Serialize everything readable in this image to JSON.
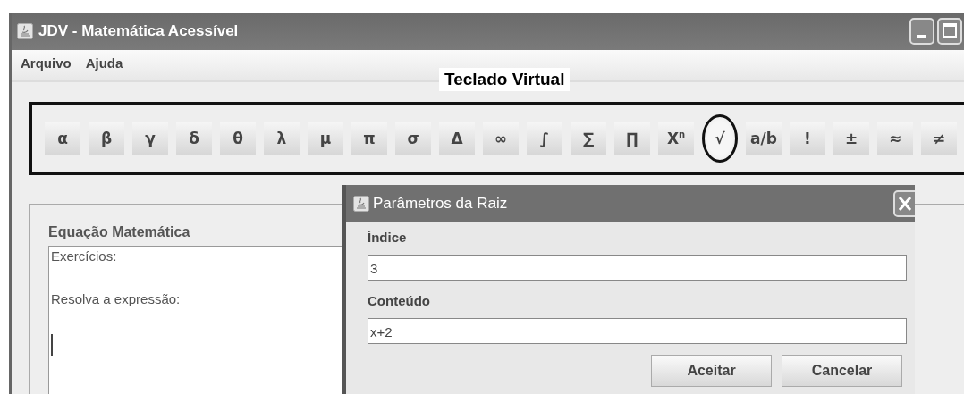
{
  "window": {
    "title": "JDV - Matemática Acessível"
  },
  "menu": [
    {
      "label": "Arquivo"
    },
    {
      "label": "Ajuda"
    }
  ],
  "keyboard": {
    "title": "Teclado Virtual",
    "keys": [
      {
        "label": "α",
        "circled": false
      },
      {
        "label": "β",
        "circled": false
      },
      {
        "label": "γ",
        "circled": false
      },
      {
        "label": "δ",
        "circled": false
      },
      {
        "label": "θ",
        "circled": false
      },
      {
        "label": "λ",
        "circled": false
      },
      {
        "label": "μ",
        "circled": false
      },
      {
        "label": "π",
        "circled": false
      },
      {
        "label": "σ",
        "circled": false
      },
      {
        "label": "Δ",
        "circled": false
      },
      {
        "label": "∞",
        "circled": false
      },
      {
        "label": "∫",
        "circled": false
      },
      {
        "label": "∑",
        "circled": false
      },
      {
        "label": "∏",
        "circled": false
      },
      {
        "label": "X$^{n}$",
        "circled": false
      },
      {
        "label": "√",
        "circled": true
      },
      {
        "label": "a/b",
        "circled": false
      },
      {
        "label": "!",
        "circled": false
      },
      {
        "label": "±",
        "circled": false
      },
      {
        "label": "≈",
        "circled": false
      },
      {
        "label": "≠",
        "circled": false
      }
    ]
  },
  "equation": {
    "title": "Equação Matemática",
    "lines": [
      "Exercícios:",
      "Resolva a expressão:"
    ]
  },
  "dialog": {
    "title": "Parâmetros da Raiz",
    "fields": [
      {
        "label": "Índice",
        "value": "3"
      },
      {
        "label": "Conteúdo",
        "value": "x+2"
      }
    ],
    "buttons": [
      "Aceitar",
      "Cancelar"
    ]
  }
}
